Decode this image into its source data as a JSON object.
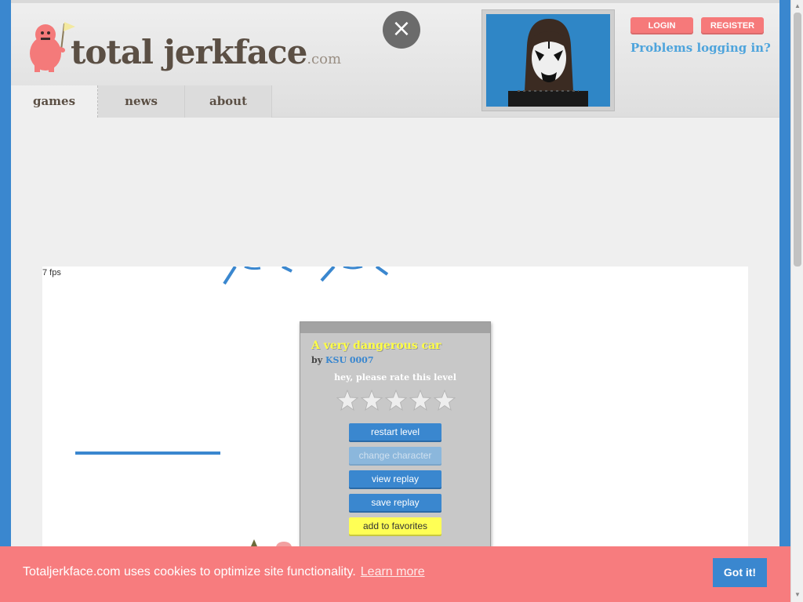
{
  "header": {
    "logo_text": "total jerkface",
    "logo_tld": ".com",
    "close_symbol": "×",
    "login_label": "LOGIN",
    "register_label": "REGISTER",
    "problems_link": "Problems logging in?"
  },
  "nav": {
    "tabs": [
      {
        "label": "games",
        "active": true
      },
      {
        "label": "news",
        "active": false
      },
      {
        "label": "about",
        "active": false
      }
    ]
  },
  "game": {
    "fps": "7 fps",
    "dialog": {
      "title": "A very dangerous car",
      "by_label": "by",
      "author": "KSU 0007",
      "rate_prompt": "hey, please rate this level",
      "stars": 5,
      "buttons": {
        "restart": "restart level",
        "change_character": "change character",
        "view_replay": "view replay",
        "save_replay": "save replay",
        "add_favorites": "add to favorites"
      }
    }
  },
  "cookie": {
    "message": "Totaljerkface.com uses cookies to optimize site functionality.",
    "learn_more": "Learn more",
    "accept": "Got it!"
  },
  "colors": {
    "accent_blue": "#3a87cf",
    "cookie_bg": "#f77c7e",
    "auth_button": "#f6797a",
    "title_yellow": "#ffff44"
  }
}
